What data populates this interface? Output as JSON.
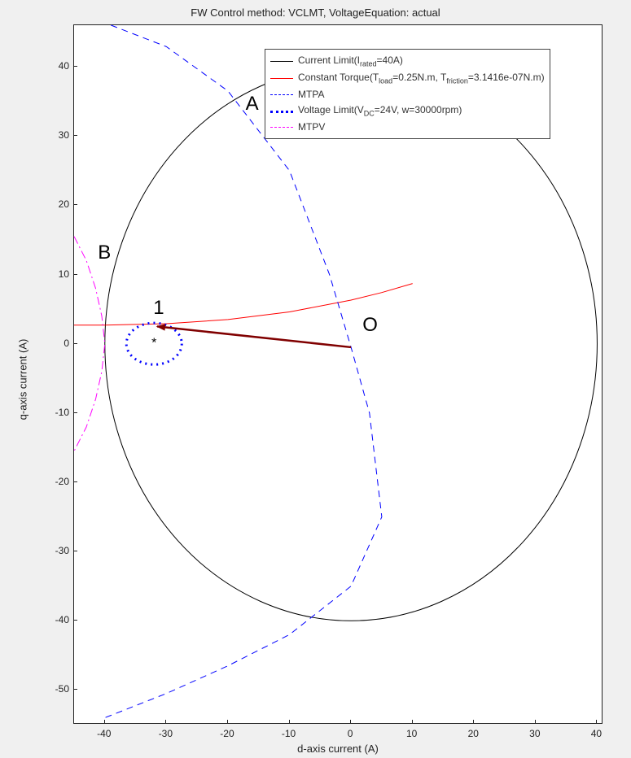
{
  "chart_data": {
    "type": "line",
    "title": "FW Control method: VCLMT, VoltageEquation: actual",
    "xlabel": "d-axis current (A)",
    "ylabel": "q-axis current (A)",
    "xlim": [
      -45,
      41
    ],
    "ylim": [
      -55,
      46
    ],
    "xticks": [
      -40,
      -30,
      -20,
      -10,
      0,
      10,
      20,
      30,
      40
    ],
    "yticks": [
      -50,
      -40,
      -30,
      -20,
      -10,
      0,
      10,
      20,
      30,
      40
    ],
    "series": [
      {
        "name": "Current Limit(I_rated=40A)",
        "color": "#000000",
        "style": "solid",
        "shape": "circle",
        "center": [
          0,
          0
        ],
        "radius": 40
      },
      {
        "name": "Constant Torque(T_load=0.25N.m, T_friction=3.1416e-07N.m)",
        "color": "#ff0000",
        "style": "solid",
        "points_x": [
          -45,
          -40,
          -30,
          -20,
          -10,
          0,
          5,
          10
        ],
        "points_y": [
          2.7,
          2.7,
          2.9,
          3.5,
          4.6,
          6.3,
          7.4,
          8.7
        ]
      },
      {
        "name": "MTPA",
        "color": "#0000ff",
        "style": "dashed",
        "points_x": [
          -39,
          -30,
          -20,
          -10,
          -3.5,
          0,
          3,
          5,
          0,
          -10,
          -20,
          -30,
          -40
        ],
        "points_y": [
          46,
          42.9,
          36.5,
          25,
          10,
          -0.5,
          -10,
          -25,
          -35,
          -42,
          -46.5,
          -50.5,
          -54
        ]
      },
      {
        "name": "Voltage Limit(V_DC=24V, w=30000rpm)",
        "color": "#0000ff",
        "style": "dotted-thick",
        "shape": "ellipse",
        "center": [
          -32,
          0
        ],
        "rx": 4.5,
        "ry": 3.0
      },
      {
        "name": "MTPV",
        "color": "#ff00ff",
        "style": "dashdot",
        "points_x": [
          -45,
          -43,
          -41.5,
          -40.5,
          -40,
          -40.5,
          -41.5,
          -43,
          -45
        ],
        "points_y": [
          15.5,
          12,
          8,
          4,
          0,
          -4,
          -8,
          -12,
          -15.5
        ]
      },
      {
        "name": "trajectory",
        "color": "#800000",
        "style": "solid-thick",
        "points_x": [
          0,
          -31.5
        ],
        "points_y": [
          -0.5,
          2.5
        ]
      }
    ],
    "markers": [
      {
        "label": "*",
        "x": -32,
        "y": 0
      }
    ],
    "annotations": [
      {
        "text": "A",
        "x": -17,
        "y": 34.5
      },
      {
        "text": "B",
        "x": -41,
        "y": 13
      },
      {
        "text": "1",
        "x": -32,
        "y": 5
      },
      {
        "text": "O",
        "x": 2,
        "y": 2.5
      }
    ],
    "legend": [
      {
        "label_html": "Current Limit(I<sub>rated</sub>=40A)",
        "color": "#000000",
        "style": "solid"
      },
      {
        "label_html": "Constant Torque(T<sub>load</sub>=0.25N.m, T<sub>friction</sub>=3.1416e-07N.m)",
        "color": "#ff0000",
        "style": "solid"
      },
      {
        "label_html": "MTPA",
        "color": "#0000ff",
        "style": "dashed"
      },
      {
        "label_html": "Voltage Limit(V<sub>DC</sub>=24V, w=30000rpm)",
        "color": "#0000ff",
        "style": "dotted-thick"
      },
      {
        "label_html": "MTPV",
        "color": "#ff00ff",
        "style": "dashdot"
      }
    ]
  }
}
